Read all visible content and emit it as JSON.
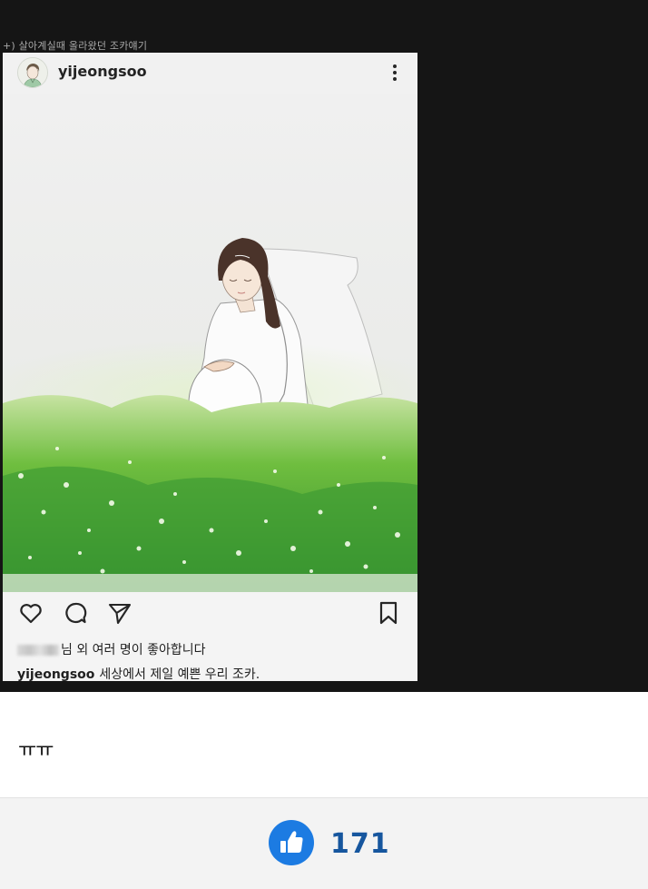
{
  "top_caption": "+) 살아계실때 올라왔던 조카얘기",
  "post": {
    "username": "yijeongsoo",
    "likes_text": "님 외 여러 명이 좋아합니다",
    "caption_user": "yijeongsoo",
    "caption_text": "세상에서 제일 예쁜 우리 조카."
  },
  "icons": {
    "more": "more-vertical-icon",
    "like": "heart-icon",
    "comment": "comment-icon",
    "share": "send-icon",
    "save": "bookmark-icon",
    "thumbs_up": "thumbs-up-icon"
  },
  "comment": {
    "text": "ㅠㅠ"
  },
  "footer": {
    "like_count": "171"
  },
  "colors": {
    "like_button": "#1c7be2",
    "like_count": "#16569e",
    "dark_background": "#151515"
  }
}
